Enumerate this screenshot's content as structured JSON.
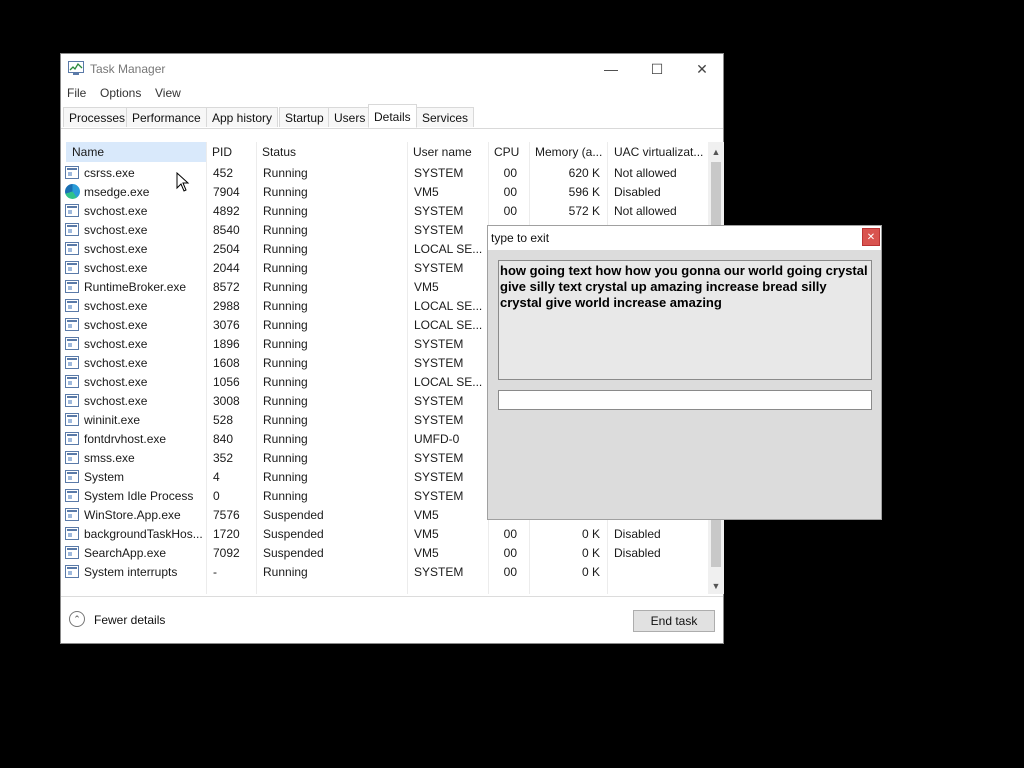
{
  "window": {
    "title": "Task Manager",
    "minimize": "—",
    "maximize": "☐",
    "close": "✕"
  },
  "menu": [
    "File",
    "Options",
    "View"
  ],
  "tabs": [
    "Processes",
    "Performance",
    "App history",
    "Startup",
    "Users",
    "Details",
    "Services"
  ],
  "active_tab": "Details",
  "columns": [
    "Name",
    "PID",
    "Status",
    "User name",
    "CPU",
    "Memory (a...",
    "UAC virtualizat..."
  ],
  "rows": [
    {
      "name": "csrss.exe",
      "pid": "452",
      "status": "Running",
      "user": "SYSTEM",
      "cpu": "00",
      "mem": "620 K",
      "uac": "Not allowed"
    },
    {
      "name": "msedge.exe",
      "pid": "7904",
      "status": "Running",
      "user": "VM5",
      "cpu": "00",
      "mem": "596 K",
      "uac": "Disabled",
      "icon": "edge"
    },
    {
      "name": "svchost.exe",
      "pid": "4892",
      "status": "Running",
      "user": "SYSTEM",
      "cpu": "00",
      "mem": "572 K",
      "uac": "Not allowed"
    },
    {
      "name": "svchost.exe",
      "pid": "8540",
      "status": "Running",
      "user": "SYSTEM",
      "cpu": "",
      "mem": "",
      "uac": ""
    },
    {
      "name": "svchost.exe",
      "pid": "2504",
      "status": "Running",
      "user": "LOCAL SE...",
      "cpu": "",
      "mem": "",
      "uac": ""
    },
    {
      "name": "svchost.exe",
      "pid": "2044",
      "status": "Running",
      "user": "SYSTEM",
      "cpu": "",
      "mem": "",
      "uac": ""
    },
    {
      "name": "RuntimeBroker.exe",
      "pid": "8572",
      "status": "Running",
      "user": "VM5",
      "cpu": "",
      "mem": "",
      "uac": ""
    },
    {
      "name": "svchost.exe",
      "pid": "2988",
      "status": "Running",
      "user": "LOCAL SE...",
      "cpu": "",
      "mem": "",
      "uac": ""
    },
    {
      "name": "svchost.exe",
      "pid": "3076",
      "status": "Running",
      "user": "LOCAL SE...",
      "cpu": "",
      "mem": "",
      "uac": ""
    },
    {
      "name": "svchost.exe",
      "pid": "1896",
      "status": "Running",
      "user": "SYSTEM",
      "cpu": "",
      "mem": "",
      "uac": ""
    },
    {
      "name": "svchost.exe",
      "pid": "1608",
      "status": "Running",
      "user": "SYSTEM",
      "cpu": "",
      "mem": "",
      "uac": ""
    },
    {
      "name": "svchost.exe",
      "pid": "1056",
      "status": "Running",
      "user": "LOCAL SE...",
      "cpu": "",
      "mem": "",
      "uac": ""
    },
    {
      "name": "svchost.exe",
      "pid": "3008",
      "status": "Running",
      "user": "SYSTEM",
      "cpu": "",
      "mem": "",
      "uac": ""
    },
    {
      "name": "wininit.exe",
      "pid": "528",
      "status": "Running",
      "user": "SYSTEM",
      "cpu": "",
      "mem": "",
      "uac": ""
    },
    {
      "name": "fontdrvhost.exe",
      "pid": "840",
      "status": "Running",
      "user": "UMFD-0",
      "cpu": "",
      "mem": "",
      "uac": ""
    },
    {
      "name": "smss.exe",
      "pid": "352",
      "status": "Running",
      "user": "SYSTEM",
      "cpu": "",
      "mem": "",
      "uac": ""
    },
    {
      "name": "System",
      "pid": "4",
      "status": "Running",
      "user": "SYSTEM",
      "cpu": "",
      "mem": "",
      "uac": ""
    },
    {
      "name": "System Idle Process",
      "pid": "0",
      "status": "Running",
      "user": "SYSTEM",
      "cpu": "",
      "mem": "",
      "uac": ""
    },
    {
      "name": "WinStore.App.exe",
      "pid": "7576",
      "status": "Suspended",
      "user": "VM5",
      "cpu": "",
      "mem": "",
      "uac": ""
    },
    {
      "name": "backgroundTaskHos...",
      "pid": "1720",
      "status": "Suspended",
      "user": "VM5",
      "cpu": "00",
      "mem": "0 K",
      "uac": "Disabled"
    },
    {
      "name": "SearchApp.exe",
      "pid": "7092",
      "status": "Suspended",
      "user": "VM5",
      "cpu": "00",
      "mem": "0 K",
      "uac": "Disabled"
    },
    {
      "name": "System interrupts",
      "pid": "-",
      "status": "Running",
      "user": "SYSTEM",
      "cpu": "00",
      "mem": "0 K",
      "uac": ""
    }
  ],
  "footer": {
    "fewer_details": "Fewer details",
    "end_task": "End task"
  },
  "dialog": {
    "title": "type to exit",
    "close": "✕",
    "text": "how going text how how you gonna our world going crystal give silly text crystal up amazing increase bread silly crystal give world increase amazing",
    "input_value": ""
  },
  "colors": {
    "background": "#000000",
    "sorted_header": "#d9e9fb",
    "dialog_close": "#d9534f"
  }
}
